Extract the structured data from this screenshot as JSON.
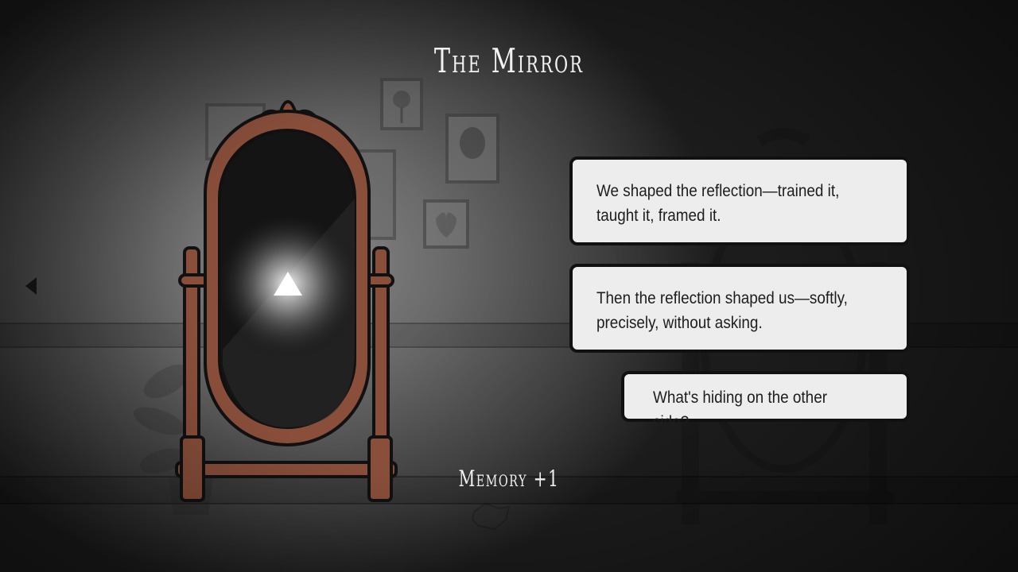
{
  "scene": {
    "title": "The Mirror",
    "memory_label": "Memory +1"
  },
  "dialog": {
    "lines": [
      "We shaped the reflection—trained it, taught it, framed it.",
      "Then the reflection shaped us—softly, precisely, without asking."
    ],
    "choice": "What's hiding on the other side?"
  },
  "icons": {
    "back": "back-arrow-icon",
    "interact": "triangle-interact-icon"
  },
  "colors": {
    "frame": "#8a4f3b",
    "outline": "#111111",
    "dialog_bg": "#ededed"
  }
}
